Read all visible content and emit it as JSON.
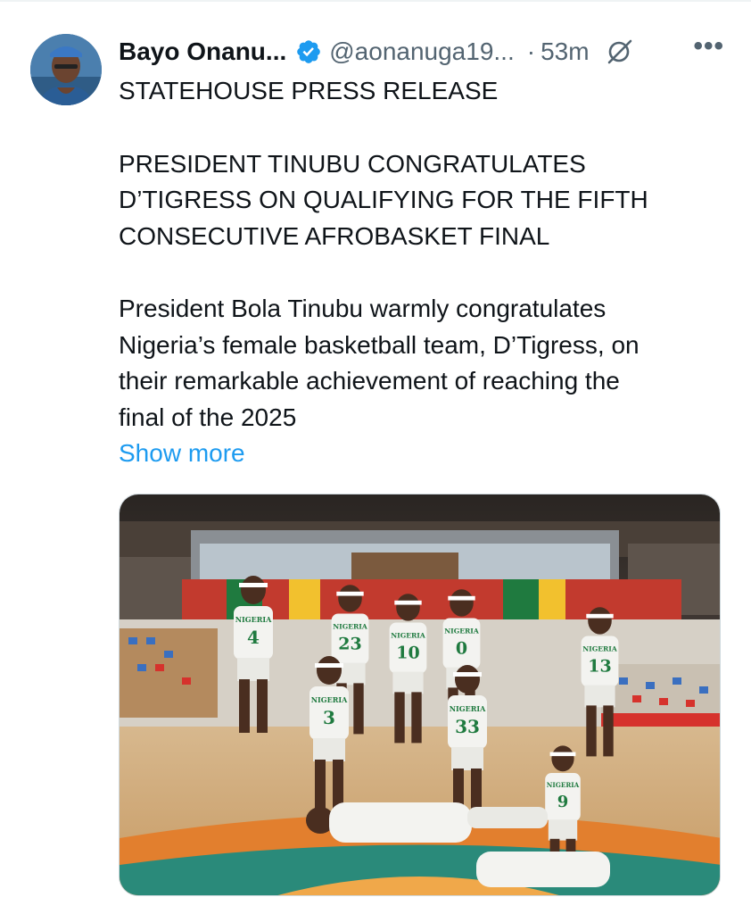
{
  "tweet": {
    "display_name": "Bayo Onanu...",
    "handle": "@aonanuga19...",
    "separator": "·",
    "time": "53m",
    "more_label": "•••",
    "title": "STATEHOUSE PRESS RELEASE",
    "headline_lines": [
      "PRESIDENT TINUBU CONGRATULATES",
      "D’TIGRESS ON QUALIFYING FOR THE FIFTH",
      "CONSECUTIVE AFROBASKET FINAL"
    ],
    "body_lines": [
      "President Bola Tinubu warmly congratulates",
      "Nigeria’s female basketball team, D’Tigress, on",
      "their remarkable achievement of reaching the",
      "final of the 2025"
    ],
    "show_more": "Show more"
  },
  "photo": {
    "jersey_text": "NIGERIA",
    "jersey_numbers": [
      "4",
      "23",
      "10",
      "0",
      "13",
      "3",
      "33",
      "9"
    ]
  },
  "colors": {
    "link": "#1d9bf0",
    "verified": "#1d9bf0",
    "secondary_text": "#536471",
    "jersey_green": "#1f7a3f"
  },
  "icons": [
    "verified-badge-icon",
    "grok-icon",
    "more-icon"
  ]
}
